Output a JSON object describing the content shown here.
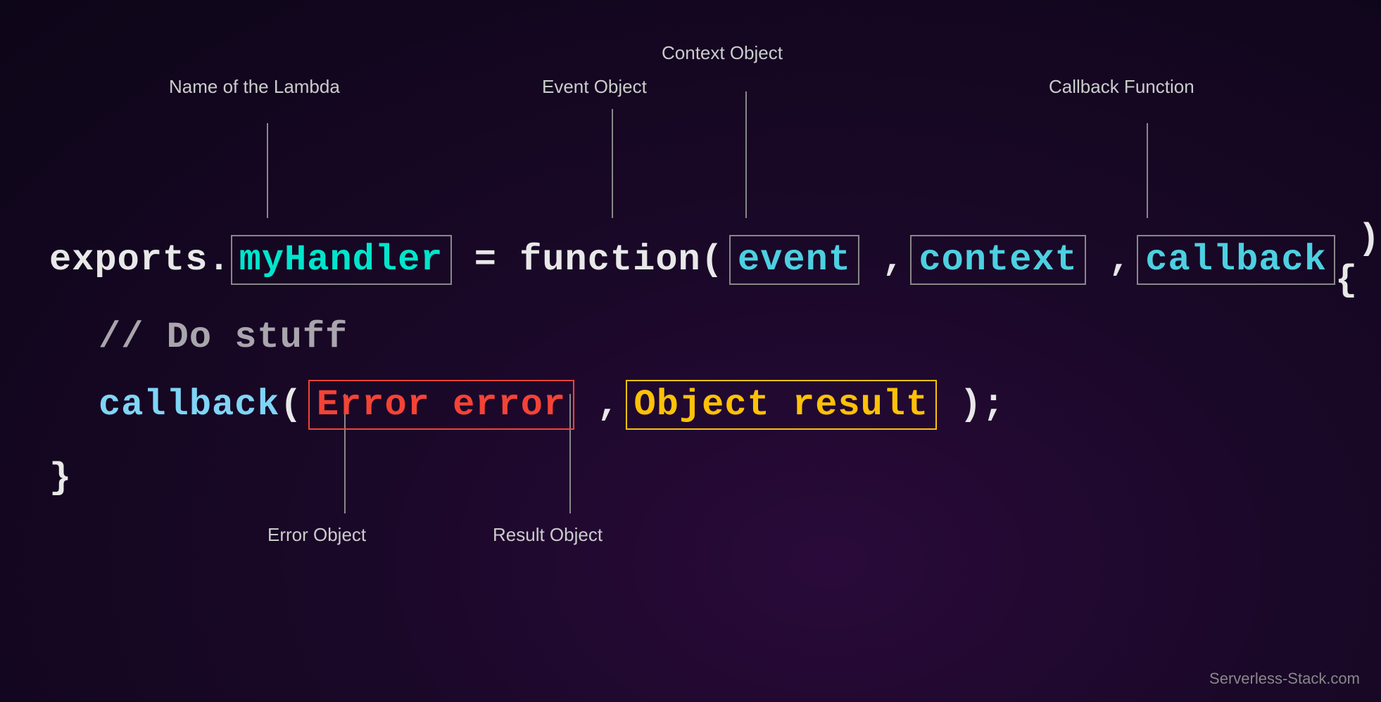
{
  "labels": {
    "lambda_name": "Name of the Lambda",
    "event_object": "Event Object",
    "context_object": "Context Object",
    "callback_function": "Callback Function",
    "error_object": "Error Object",
    "result_object": "Result Object"
  },
  "code": {
    "line1_prefix": "exports.",
    "handler": "myHandler",
    "line1_mid": " = ",
    "function": "function",
    "open_paren": "(",
    "event": "event",
    "comma1": " ,",
    "context": "context",
    "comma2": " ,",
    "callback": "callback",
    "close_paren": " ) {",
    "comment": "//  Do stuff",
    "callback2": "callback",
    "open_paren2": "(",
    "error_error": "Error error",
    "comma3": " ,",
    "object_result": "Object result",
    "close_paren2": " );",
    "close_brace": "}"
  },
  "watermark": "Serverless-Stack.com",
  "colors": {
    "background_start": "#2a0a3a",
    "background_end": "#0d0518",
    "label_color": "#cccccc",
    "connector_color": "#888888",
    "white_code": "#e8e8e8",
    "cyan_code": "#00e5cc",
    "blue_code": "#4dd0e1",
    "red_code": "#f44336",
    "yellow_code": "#ffc107"
  }
}
